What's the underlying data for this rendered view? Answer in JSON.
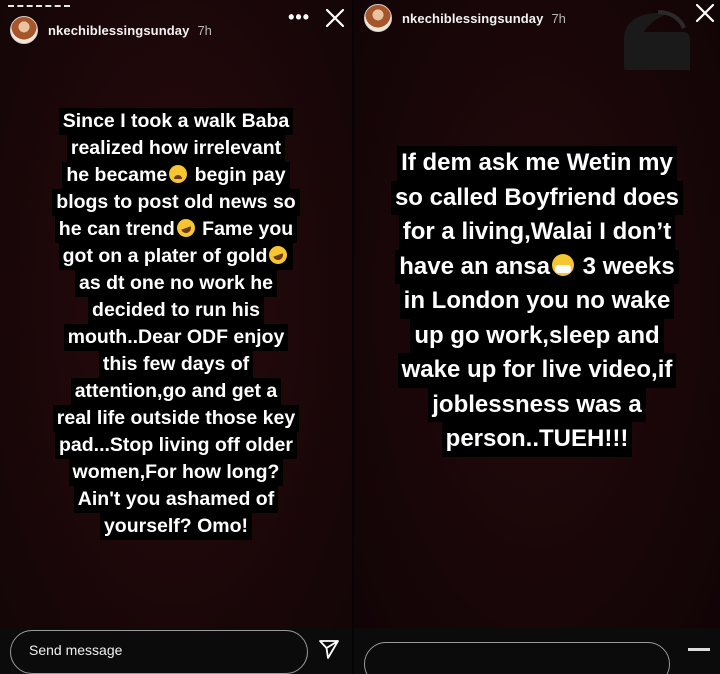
{
  "left_story": {
    "username": "nkechiblessingsunday",
    "time": "7h",
    "more_label": "•••",
    "lines": [
      "Since I took a walk Baba",
      "realized how irrelevant",
      "he became",
      "begin pay",
      "blogs to post old news so",
      "he can trend",
      "Fame you",
      "got on a plater of gold",
      "as dt one no work he",
      "decided to run his",
      "mouth..Dear ODF enjoy",
      "this few days of",
      "attention,go and get a",
      "real life outside those key",
      "pad...Stop living off older",
      "women,For how long?",
      "Ain't you ashamed of",
      "yourself? Omo!"
    ],
    "send_placeholder": "Send message"
  },
  "right_story": {
    "username": "nkechiblessingsunday",
    "time": "7h",
    "lines": [
      "If dem ask me Wetin my",
      "so called Boyfriend does",
      "for a living,Walai I don’t",
      "have an ansa",
      "3 weeks",
      "in London you no wake",
      "up go work,sleep and",
      "wake up for live video,if",
      "joblessness was a",
      "person..TUEH!!!"
    ]
  },
  "colors": {
    "background": "#1c0709",
    "text_highlight": "#000000",
    "text": "#ffffff"
  },
  "icons": {
    "close": "close-icon",
    "more": "more-icon",
    "send": "send-icon",
    "emoji_weary": "weary-face-emoji-icon",
    "emoji_rofl": "rolling-laughing-emoji-icon",
    "emoji_mask": "medical-mask-emoji-icon"
  }
}
